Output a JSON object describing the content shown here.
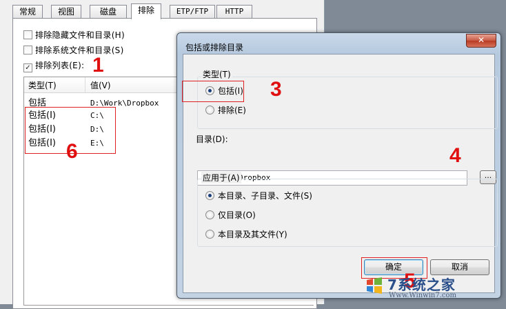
{
  "tabs": [
    {
      "label": "常规"
    },
    {
      "label": "视图"
    },
    {
      "label": "磁盘"
    },
    {
      "label": "排除"
    },
    {
      "label": "ETP/FTP"
    },
    {
      "label": "HTTP"
    }
  ],
  "exclusions": {
    "hidden_label": "排除隐藏文件和目录(H)",
    "system_label": "排除系统文件和目录(S)",
    "list_label": "排除列表(E):",
    "hidden_checked": false,
    "system_checked": false,
    "list_checked": true
  },
  "list": {
    "columns": [
      "类型(T)",
      "值(V)"
    ],
    "rows": [
      {
        "type": "包括",
        "value": "D:\\Work\\Dropbox"
      },
      {
        "type": "包括(I)",
        "value": "C:\\"
      },
      {
        "type": "包括(I)",
        "value": "D:\\"
      },
      {
        "type": "包括(I)",
        "value": "E:\\"
      }
    ]
  },
  "dialog": {
    "title": "包括或排除目录",
    "close_glyph": "✕",
    "type_group_label": "类型(T)",
    "include_label": "包括(I)",
    "exclude_label": "排除(E)",
    "include_selected": true,
    "dir_label": "目录(D):",
    "dir_value": "D:\\Work\\Dropbox",
    "browse_label": "...",
    "apply_group_label": "应用于(A)",
    "apply_options": [
      {
        "label": "本目录、子目录、文件(S)",
        "selected": true
      },
      {
        "label": "仅目录(O)",
        "selected": false
      },
      {
        "label": "本目录及其文件(Y)",
        "selected": false
      }
    ],
    "ok_label": "确定",
    "cancel_label": "取消"
  },
  "annotations": {
    "n1": "1",
    "n3": "3",
    "n4": "4",
    "n5": "5",
    "n6": "6"
  },
  "watermark": {
    "title": "7系统之家",
    "url": "Www.Winwin7.com"
  },
  "colors": {
    "annotation": "#e01010",
    "dialog_frame": "#b6c9de",
    "close_button": "#c75a44"
  }
}
